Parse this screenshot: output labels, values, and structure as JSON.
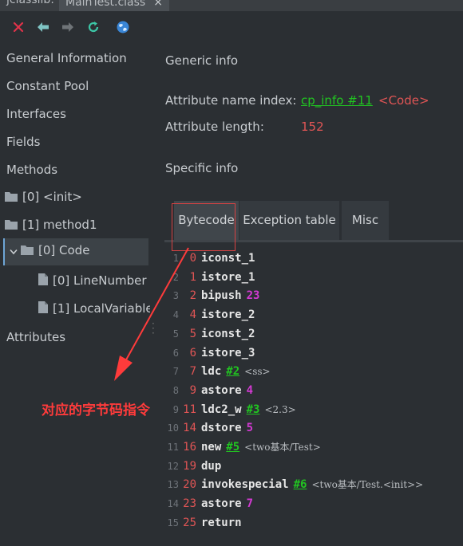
{
  "window": {
    "tab_left": "jclasslib:",
    "tab_active": "MainTest.class",
    "tab_close": "×"
  },
  "toolbar": {
    "close_icon": "close-icon",
    "back_icon": "arrow-left-icon",
    "forward_icon": "arrow-right-icon",
    "refresh_icon": "refresh-icon",
    "web_icon": "globe-icon"
  },
  "sidebar": {
    "items": [
      {
        "label": "General Information"
      },
      {
        "label": "Constant Pool"
      },
      {
        "label": "Interfaces"
      },
      {
        "label": "Fields"
      },
      {
        "label": "Methods"
      },
      {
        "label": "[0] <init>"
      },
      {
        "label": "[1] method1"
      },
      {
        "label": "[0] Code"
      },
      {
        "label": "[0] LineNumber"
      },
      {
        "label": "[1] LocalVariable"
      },
      {
        "label": "Attributes"
      }
    ]
  },
  "main": {
    "generic_title": "Generic info",
    "attr_name_label": "Attribute name index:",
    "attr_name_link": "cp_info #11",
    "attr_name_value": "<Code>",
    "attr_length_label": "Attribute length:",
    "attr_length_value": "152",
    "specific_title": "Specific info",
    "tabs": [
      {
        "label": "Bytecode"
      },
      {
        "label": "Exception table"
      },
      {
        "label": "Misc"
      }
    ]
  },
  "bytecode": [
    {
      "ln": "1",
      "off": "0",
      "op": "iconst_1",
      "arg": "",
      "cp": "",
      "cmt": ""
    },
    {
      "ln": "2",
      "off": "1",
      "op": "istore_1",
      "arg": "",
      "cp": "",
      "cmt": ""
    },
    {
      "ln": "3",
      "off": "2",
      "op": "bipush",
      "arg": "23",
      "cp": "",
      "cmt": ""
    },
    {
      "ln": "4",
      "off": "4",
      "op": "istore_2",
      "arg": "",
      "cp": "",
      "cmt": ""
    },
    {
      "ln": "5",
      "off": "5",
      "op": "iconst_2",
      "arg": "",
      "cp": "",
      "cmt": ""
    },
    {
      "ln": "6",
      "off": "6",
      "op": "istore_3",
      "arg": "",
      "cp": "",
      "cmt": ""
    },
    {
      "ln": "7",
      "off": "7",
      "op": "ldc",
      "arg": "",
      "cp": "#2",
      "cmt": "<ss>"
    },
    {
      "ln": "8",
      "off": "9",
      "op": "astore",
      "arg": "4",
      "cp": "",
      "cmt": ""
    },
    {
      "ln": "9",
      "off": "11",
      "op": "ldc2_w",
      "arg": "",
      "cp": "#3",
      "cmt": "<2.3>"
    },
    {
      "ln": "10",
      "off": "14",
      "op": "dstore",
      "arg": "5",
      "cp": "",
      "cmt": ""
    },
    {
      "ln": "11",
      "off": "16",
      "op": "new",
      "arg": "",
      "cp": "#5",
      "cmt": "<two基本/Test>"
    },
    {
      "ln": "12",
      "off": "19",
      "op": "dup",
      "arg": "",
      "cp": "",
      "cmt": ""
    },
    {
      "ln": "13",
      "off": "20",
      "op": "invokespecial",
      "arg": "",
      "cp": "#6",
      "cmt": "<two基本/Test.<init>>"
    },
    {
      "ln": "14",
      "off": "23",
      "op": "astore",
      "arg": "7",
      "cp": "",
      "cmt": ""
    },
    {
      "ln": "15",
      "off": "25",
      "op": "return",
      "arg": "",
      "cp": "",
      "cmt": ""
    }
  ],
  "annotation": {
    "text": "对应的字节码指令",
    "color": "#ff3b3b"
  }
}
